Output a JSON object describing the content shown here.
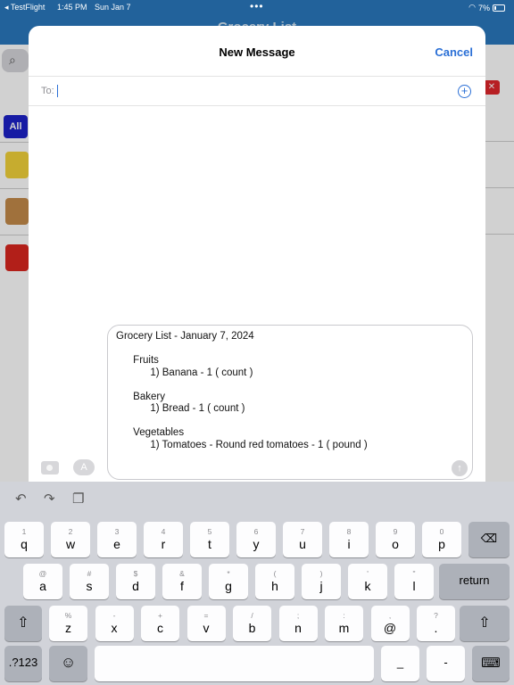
{
  "status_bar": {
    "back_app": "◂ TestFlight",
    "time": "1:45 PM",
    "date": "Sun Jan 7",
    "dots": "•••",
    "battery": "7%"
  },
  "background_app": {
    "title": "Grocery List",
    "filter_all": "All"
  },
  "compose": {
    "title": "New Message",
    "cancel": "Cancel",
    "to_label": "To:",
    "message_text": "Grocery List - January 7, 2024\n\n      Fruits\n            1) Banana - 1 ( count )\n\n      Bakery\n            1) Bread - 1 ( count )\n\n      Vegetables\n            1) Tomatoes - Round red tomatoes - 1 ( pound )"
  },
  "keyboard": {
    "row1": [
      {
        "main": "q",
        "sub": "1"
      },
      {
        "main": "w",
        "sub": "2"
      },
      {
        "main": "e",
        "sub": "3"
      },
      {
        "main": "r",
        "sub": "4"
      },
      {
        "main": "t",
        "sub": "5"
      },
      {
        "main": "y",
        "sub": "6"
      },
      {
        "main": "u",
        "sub": "7"
      },
      {
        "main": "i",
        "sub": "8"
      },
      {
        "main": "o",
        "sub": "9"
      },
      {
        "main": "p",
        "sub": "0"
      }
    ],
    "row2": [
      {
        "main": "a",
        "sub": "@"
      },
      {
        "main": "s",
        "sub": "#"
      },
      {
        "main": "d",
        "sub": "$"
      },
      {
        "main": "f",
        "sub": "&"
      },
      {
        "main": "g",
        "sub": "*"
      },
      {
        "main": "h",
        "sub": "("
      },
      {
        "main": "j",
        "sub": ")"
      },
      {
        "main": "k",
        "sub": "'"
      },
      {
        "main": "l",
        "sub": "\""
      }
    ],
    "row3": [
      {
        "main": "z",
        "sub": "%"
      },
      {
        "main": "x",
        "sub": "-"
      },
      {
        "main": "c",
        "sub": "+"
      },
      {
        "main": "v",
        "sub": "="
      },
      {
        "main": "b",
        "sub": "/"
      },
      {
        "main": "n",
        "sub": ";"
      },
      {
        "main": "m",
        "sub": ":"
      },
      {
        "main": "@",
        "sub": ","
      },
      {
        "main": ".",
        "sub": "?"
      }
    ],
    "return_label": "return",
    "numbers_label": ".?123",
    "underscore_label": "_",
    "dash_label": "-"
  },
  "icons": {
    "undo": "undo-icon",
    "redo": "redo-icon",
    "paste": "paste-icon",
    "delete": "delete-icon",
    "shift": "shift-icon",
    "emoji": "emoji-icon",
    "dismiss": "keyboard-dismiss-icon",
    "send": "send-icon",
    "camera": "camera-icon",
    "appstore": "appstore-icon",
    "add": "add-recipient-icon"
  }
}
